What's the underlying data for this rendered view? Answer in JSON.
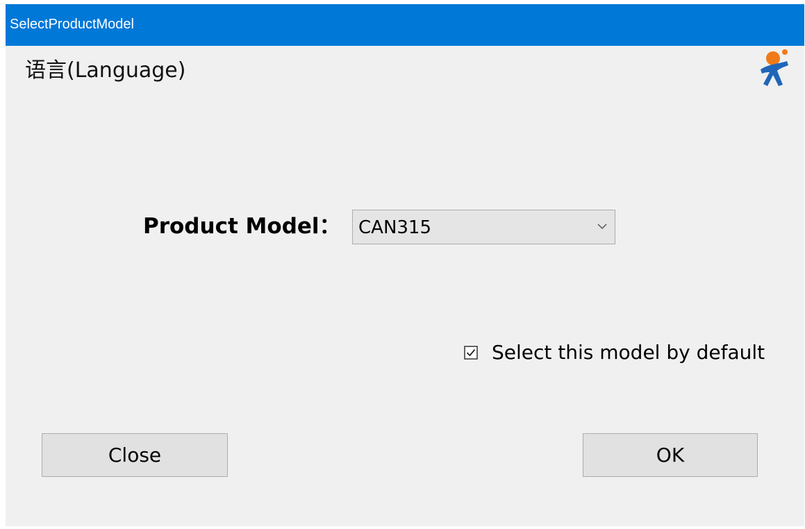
{
  "window": {
    "title": "SelectProductModel"
  },
  "language": {
    "label": "语言(Language)"
  },
  "form": {
    "model_label": "Product Model：",
    "model_value": "CAN315",
    "default_checkbox_label": "Select this model by default",
    "default_checked": true
  },
  "buttons": {
    "close_label": "Close",
    "ok_label": "OK"
  },
  "colors": {
    "titlebar": "#0078d7",
    "logo_head": "#f07a1a",
    "logo_body": "#1f66b8"
  },
  "icons": {
    "logo": "running-person-logo",
    "dropdown": "chevron-down-icon",
    "checkbox": "checkbox-checked-icon"
  }
}
